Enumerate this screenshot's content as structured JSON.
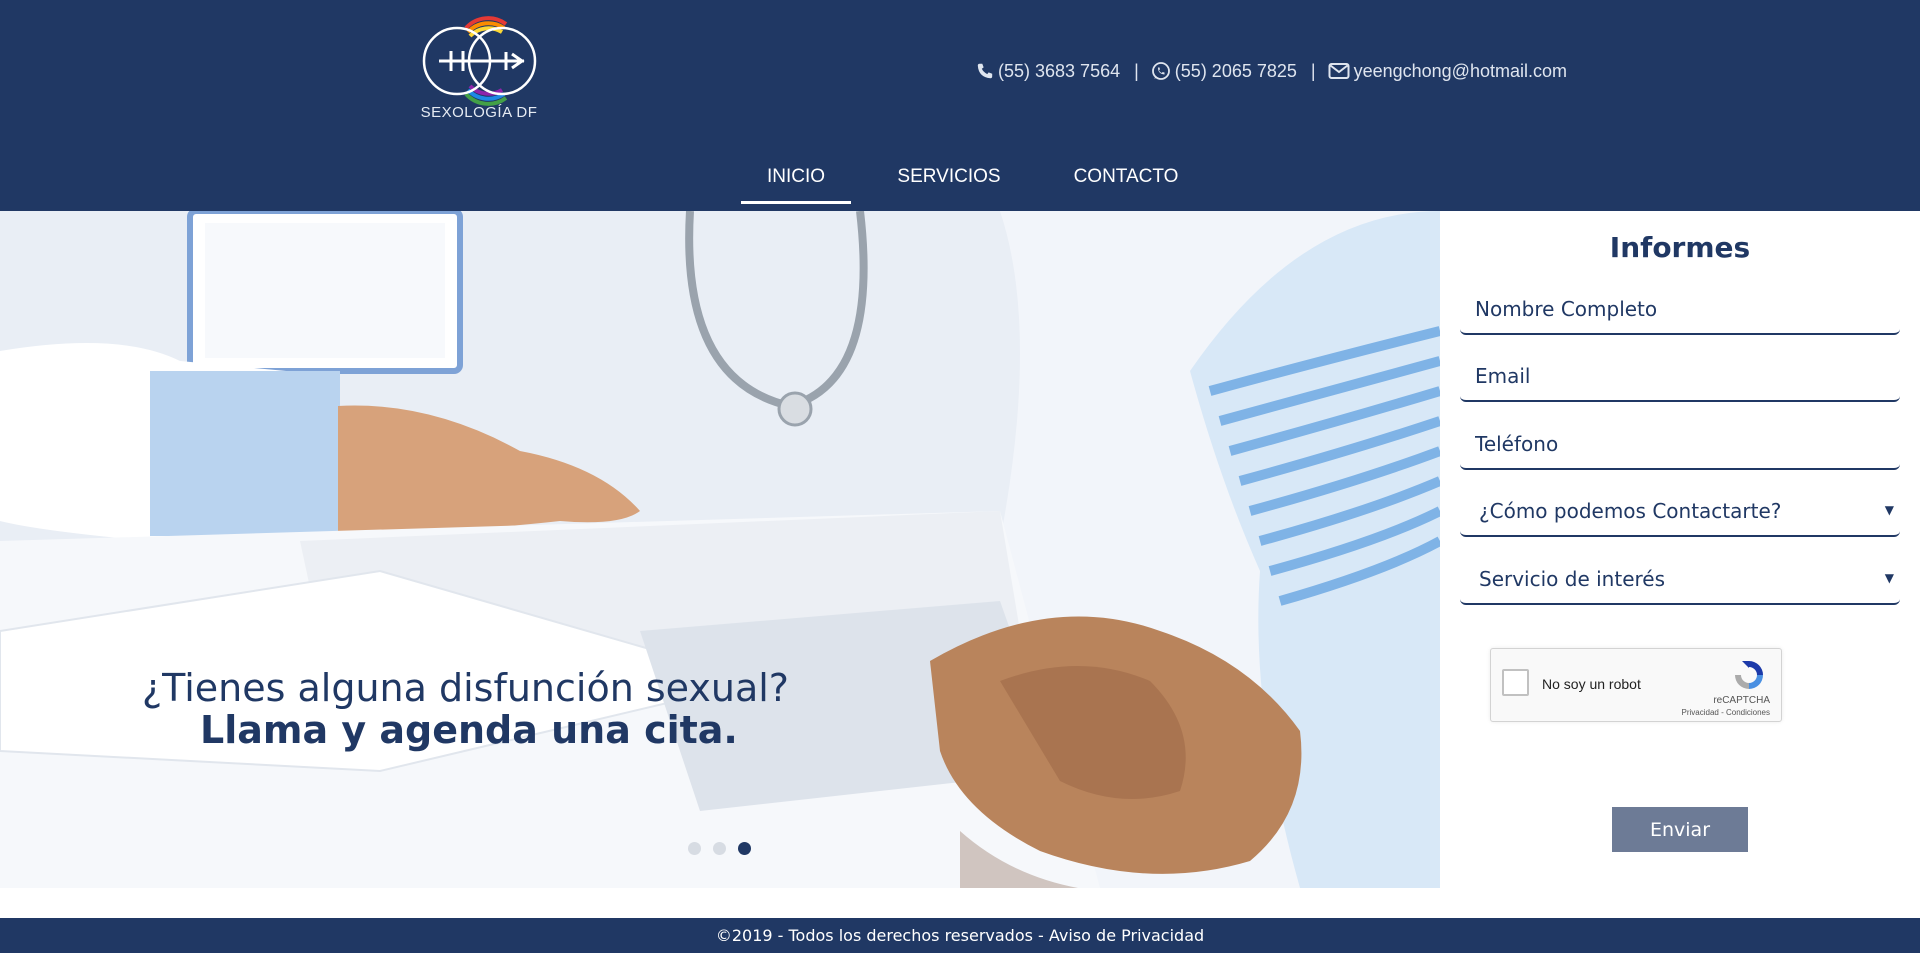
{
  "brand": {
    "logo_text": "SEXOLOGÍA DF",
    "logo_icon": "two-circles-rainbow-logo",
    "colors": {
      "primary": "#203864",
      "button": "#6d7b96",
      "rainbow": [
        "#e53935",
        "#fb8c00",
        "#fdd835",
        "#43a047",
        "#1e88e5",
        "#8e24aa"
      ]
    }
  },
  "contact": {
    "phone": {
      "icon": "phone-icon",
      "text": "(55) 3683 7564"
    },
    "whatsapp": {
      "icon": "whatsapp-icon",
      "text": "(55) 2065 7825"
    },
    "email": {
      "icon": "envelope-icon",
      "text": "yeengchong@hotmail.com"
    },
    "separator": "|"
  },
  "nav": {
    "items": [
      {
        "label": "INICIO",
        "active": true
      },
      {
        "label": "SERVICIOS",
        "active": false
      },
      {
        "label": "CONTACTO",
        "active": false
      }
    ]
  },
  "hero": {
    "line1": "¿Tienes alguna disfunción sexual?",
    "line2": "Llama y agenda una cita.",
    "slides": {
      "count": 3,
      "active": 3
    }
  },
  "form": {
    "title": "Informes",
    "name_placeholder": "Nombre Completo",
    "email_placeholder": "Email",
    "phone_placeholder": "Teléfono",
    "contact_method_select": "¿Cómo podemos Contactarte?",
    "service_select": "Servicio de interés",
    "select_arrow": "▼",
    "recaptcha": {
      "label": "No soy un robot",
      "brand": "reCAPTCHA",
      "terms": "Privacidad - Condiciones"
    },
    "submit_label": "Enviar"
  },
  "footer": {
    "text": "©2019 - Todos los derechos reservados - ",
    "privacy_link": "Aviso de Privacidad"
  }
}
